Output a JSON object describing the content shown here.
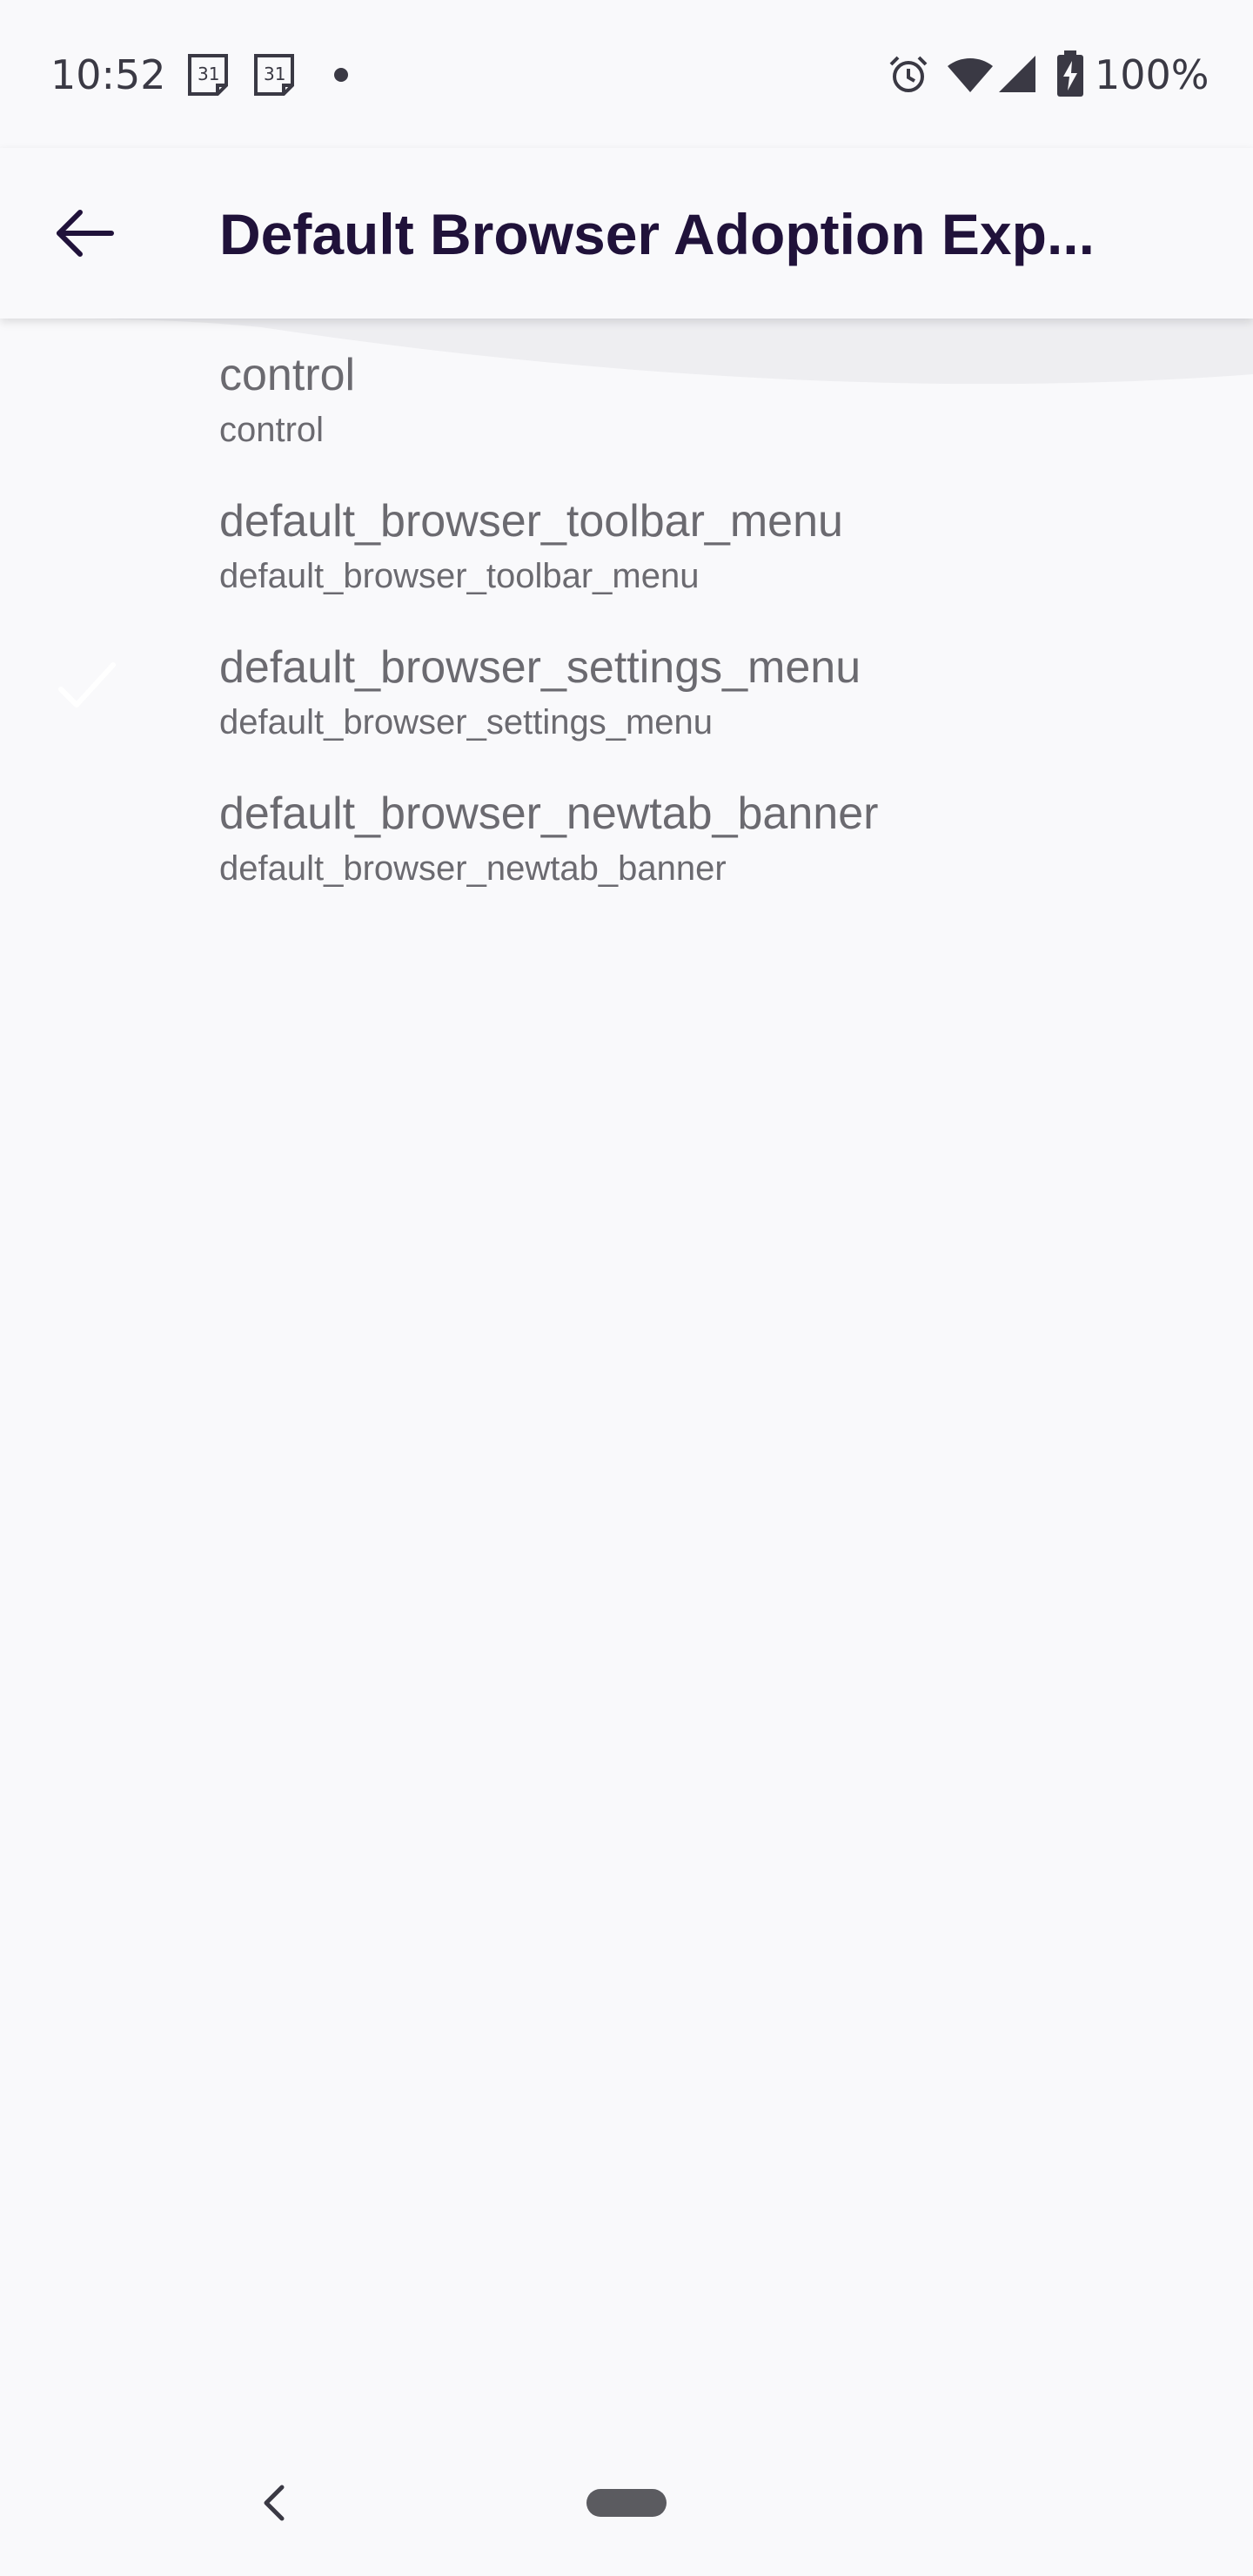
{
  "status_bar": {
    "time": "10:52",
    "battery": "100%",
    "icons": [
      "calendar-icon",
      "calendar-icon",
      "notification-dot-icon",
      "alarm-icon",
      "wifi-icon",
      "signal-icon",
      "battery-charging-icon"
    ],
    "calendar_day": "31"
  },
  "toolbar": {
    "title": "Default Browser Adoption Exp...",
    "back_icon": "arrow-left-icon"
  },
  "list": {
    "items": [
      {
        "title": "control",
        "subtitle": "control",
        "selected": false
      },
      {
        "title": "default_browser_toolbar_menu",
        "subtitle": "default_browser_toolbar_menu",
        "selected": false
      },
      {
        "title": "default_browser_settings_menu",
        "subtitle": "default_browser_settings_menu",
        "selected": true
      },
      {
        "title": "default_browser_newtab_banner",
        "subtitle": "default_browser_newtab_banner",
        "selected": false
      }
    ]
  },
  "nav_bar": {
    "back_icon": "chevron-left-icon",
    "home_icon": "home-pill-icon"
  },
  "colors": {
    "background": "#f9f9fb",
    "title": "#20123a",
    "item_text": "#6b6a70",
    "check": "#ffffff"
  }
}
